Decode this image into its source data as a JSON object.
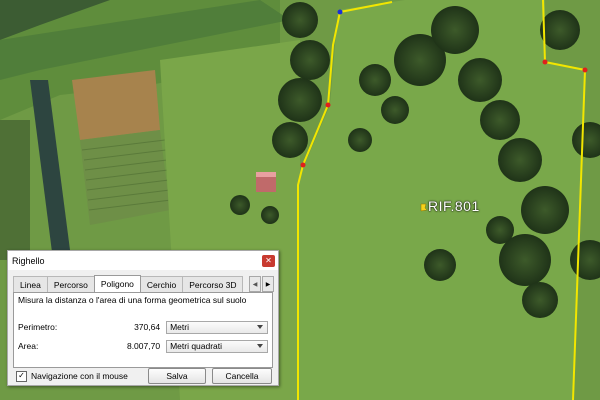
{
  "map": {
    "placemark_label": "RIF.801",
    "colors": {
      "boundary": "#f2e600",
      "vertex": "#e0201c",
      "vertex_start": "#1a2fd6"
    }
  },
  "ruler": {
    "title": "Righello",
    "close_icon": "close-icon",
    "tabs": [
      {
        "label": "Linea",
        "active": false
      },
      {
        "label": "Percorso",
        "active": false
      },
      {
        "label": "Poligono",
        "active": true
      },
      {
        "label": "Cerchio",
        "active": false
      },
      {
        "label": "Percorso 3D",
        "active": false
      }
    ],
    "description": "Misura la distanza o l'area di una forma geometrica sul suolo",
    "perimeter": {
      "label": "Perimetro:",
      "value": "370,64",
      "unit": "Metri"
    },
    "area": {
      "label": "Area:",
      "value": "8.007,70",
      "unit": "Metri quadrati"
    },
    "mouse_nav": {
      "label": "Navigazione con il mouse",
      "checked": true
    },
    "save_label": "Salva",
    "cancel_label": "Cancella"
  }
}
